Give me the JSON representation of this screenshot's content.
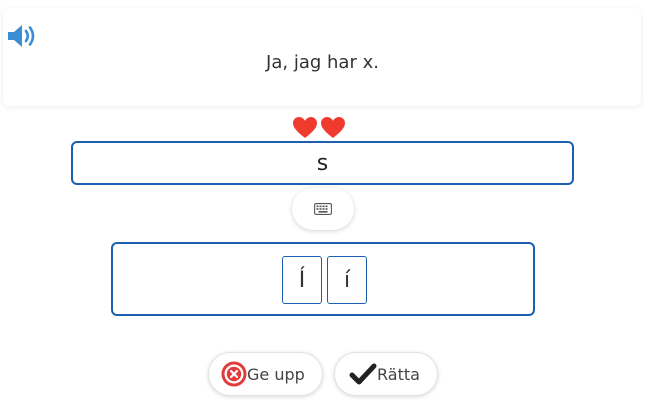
{
  "prompt": {
    "text": "Ja, jag har x.",
    "audio_icon": "speaker-icon"
  },
  "lives": {
    "count": 2,
    "icon": "heart-icon",
    "color": "#ee3b2e"
  },
  "answer": {
    "value": "s"
  },
  "keyboard_toggle": {
    "icon": "keyboard-icon"
  },
  "special_chars": [
    "Í",
    "í"
  ],
  "actions": {
    "give_up_label": "Ge upp",
    "give_up_icon": "close-circle-icon",
    "check_label": "Rätta",
    "check_icon": "checkmark-icon"
  },
  "colors": {
    "accent": "#1c5fb0",
    "speaker": "#3a8ed6",
    "give_up": "#e23b3b",
    "check": "#222222"
  }
}
